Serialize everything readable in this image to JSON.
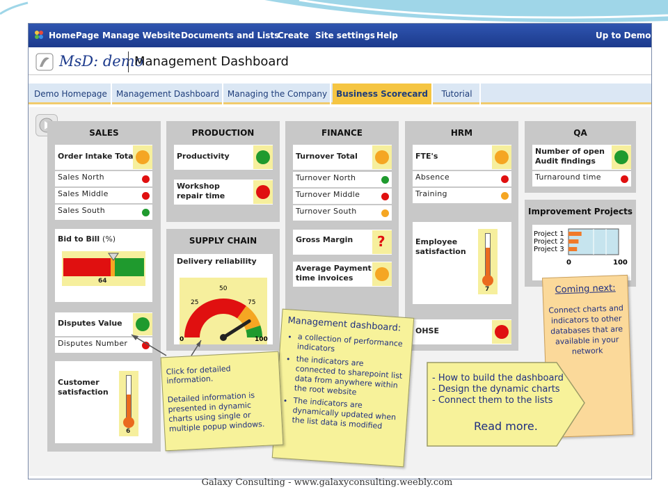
{
  "menu": {
    "items": [
      "HomePage",
      "Manage Website",
      "Documents and Lists",
      "Create",
      "Site settings",
      "Help"
    ],
    "right": "Up to Demo"
  },
  "brand": {
    "logo": "MsD: demo",
    "title": "Management Dashboard"
  },
  "tabs": [
    {
      "label": "Demo Homepage",
      "active": false
    },
    {
      "label": "Management Dashboard",
      "active": false
    },
    {
      "label": "Managing the Company",
      "active": false
    },
    {
      "label": "Business Scorecard",
      "active": true
    },
    {
      "label": "Tutorial",
      "active": false
    }
  ],
  "colors": {
    "green": "#1f9a2e",
    "red": "#e01010",
    "orange": "#f5a623",
    "nav": "#1c3a8c",
    "tab_active": "#f5c542"
  },
  "sales": {
    "title": "SALES",
    "order_intake": "Order Intake Total",
    "rows": [
      "Sales North",
      "Sales Middle",
      "Sales South"
    ],
    "bid_to_bill": "Bid to Bill",
    "bid_unit": "(%)",
    "bid_value": "64",
    "disputes": "Disputes Value",
    "disputes_number": "Disputes Number",
    "customer_satisfaction": "Customer satisfaction",
    "cs_value": "6",
    "cs_level": 0.6
  },
  "production": {
    "title": "PRODUCTION",
    "productivity": "Productivity",
    "workshop": "Workshop repair time"
  },
  "supply_chain": {
    "title": "SUPPLY CHAIN",
    "delivery": "Delivery reliability",
    "gauge_labels": [
      "0",
      "25",
      "50",
      "75",
      "100"
    ],
    "gauge_value": 82
  },
  "finance": {
    "title": "FINANCE",
    "turnover": "Turnover Total",
    "rows": [
      "Turnover North",
      "Turnover Middle",
      "Turnover South"
    ],
    "gross_margin": "Gross Margin",
    "gross_symbol": "?",
    "avg_payment": "Average Payment time invoices"
  },
  "hrm": {
    "title": "HRM",
    "ftes": "FTE's",
    "rows": [
      "Absence",
      "Training"
    ],
    "employee": "Employee satisfaction",
    "emp_value": "7",
    "emp_level": 0.7,
    "ohse": "OHSE"
  },
  "qa": {
    "title": "QA",
    "audit": "Number of open Audit findings",
    "turnaround": "Turnaround time"
  },
  "improvement": {
    "title": "Improvement Projects",
    "projects": [
      "Project 1",
      "Project 2",
      "Project 3"
    ],
    "values": [
      26,
      20,
      17
    ],
    "axis": [
      "0",
      "100"
    ]
  },
  "notes": {
    "click": {
      "line1": "Click for detailed information.",
      "body": "Detailed information is presented in dynamic charts using single or multiple popup windows."
    },
    "management": {
      "title": "Management dashboard:",
      "bullets": [
        "a collection of performance indicators",
        "the indicators are connected to sharepoint list data from anywhere within the root website",
        "The indicators are dynamically updated when the list data is modified"
      ]
    },
    "coming": {
      "title": "Coming next:",
      "body": "Connect charts and indicators to other databases that are available in your network"
    },
    "howto": {
      "lines": [
        "- How to build the dashboard",
        "- Design the dynamic charts",
        "- Connect them to the lists"
      ],
      "read_more": "Read more."
    }
  },
  "footer": "Galaxy Consulting - www.galaxyconsulting.weebly.com"
}
